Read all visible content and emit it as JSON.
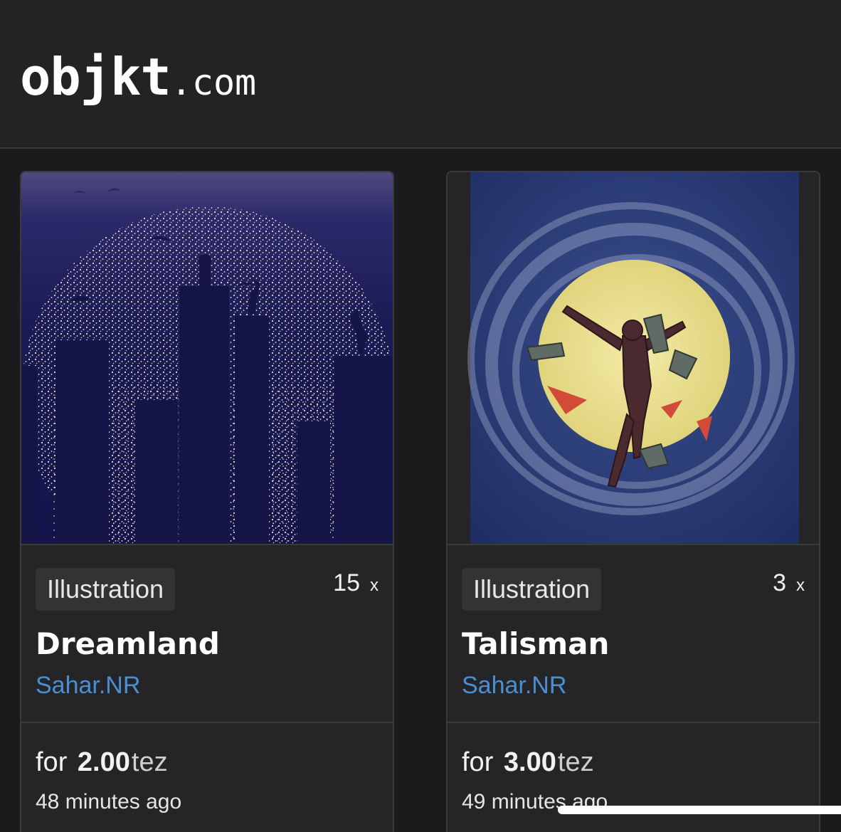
{
  "header": {
    "logo_main": "objkt",
    "logo_tld": ".com"
  },
  "cards": [
    {
      "category": "Illustration",
      "edition_count": "15",
      "edition_suffix": "x",
      "title": "Dreamland",
      "artist": "Sahar.NR",
      "price_prefix": "for",
      "price_amount": "2.00",
      "price_unit": "tez",
      "time_ago": "48 minutes ago"
    },
    {
      "category": "Illustration",
      "edition_count": "3",
      "edition_suffix": "x",
      "title": "Talisman",
      "artist": "Sahar.NR",
      "price_prefix": "for",
      "price_amount": "3.00",
      "price_unit": "tez",
      "time_ago": "49 minutes ago"
    }
  ],
  "colors": {
    "background": "#1b1b1d",
    "card_background": "#252527",
    "artist_link": "#4a8fd4",
    "tag_background": "#333336"
  }
}
